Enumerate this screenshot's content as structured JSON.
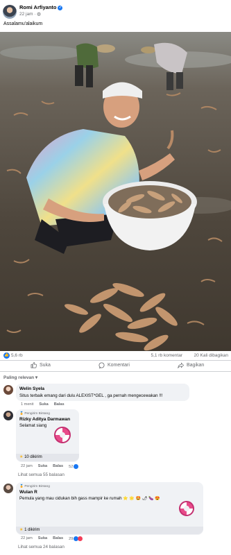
{
  "post": {
    "author": "Romi Arfiyanto",
    "time": "22 jam",
    "audience_icon": "globe-icon",
    "caption": "Assalamu'alaikum"
  },
  "stats": {
    "likes": "5,6 rb",
    "comments": "5,1 rb komentar",
    "shares": "20 Kali dibagikan"
  },
  "actions": {
    "like": "Suka",
    "comment": "Komentari",
    "share": "Bagikan"
  },
  "sort_label": "Paling relevan",
  "comments": [
    {
      "name": "Welin Syela",
      "text": "Situs terbaik emang dari dulu ALEXIST*GEL , ga pernah mengecewakan !!!",
      "time": "1 menit",
      "like": "Suka",
      "reply": "Balas"
    },
    {
      "badge": "Pengirim Bintang",
      "name": "Rizky Aditya Darmawan",
      "text": "Selamat siang",
      "stars": "10 dikirim",
      "time": "22 jam",
      "like": "Suka",
      "reply": "Balas",
      "reactions": "52",
      "view_replies": "Lihat semua 55 balasan"
    },
    {
      "badge": "Pengirim Bintang",
      "name": "Wulan R",
      "text": "Pemula yang mau cidukan bih gass mampir ke rumah",
      "stars": "1 dikirim",
      "time": "22 jam",
      "like": "Suka",
      "reply": "Balas",
      "reactions": "29",
      "view_replies": "Lihat semua 24 balasan"
    }
  ],
  "colors": {
    "accent": "#1877f2",
    "secondary_text": "#65676b",
    "bubble": "#f0f2f5",
    "star": "#f7b928"
  }
}
